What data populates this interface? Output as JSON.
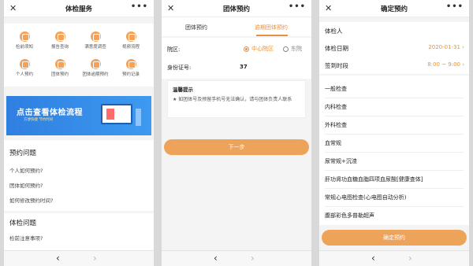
{
  "panel1": {
    "title": "体检服务",
    "grid": [
      {
        "label": "检前须知",
        "icon": "notice-icon"
      },
      {
        "label": "报告查询",
        "icon": "report-icon"
      },
      {
        "label": "满意度调查",
        "icon": "survey-icon"
      },
      {
        "label": "视频流程",
        "icon": "video-icon"
      },
      {
        "label": "个人预约",
        "icon": "personal-icon"
      },
      {
        "label": "团体预约",
        "icon": "group-icon"
      },
      {
        "label": "团体逾期预约",
        "icon": "overdue-icon"
      },
      {
        "label": "预约记录",
        "icon": "record-icon"
      }
    ],
    "banner_title": "点击查看体检流程",
    "banner_sub": "方便快捷 节约时间",
    "section1_title": "预约问题",
    "section1_items": [
      "个人如何预约?",
      "团体如何预约?",
      "如何修改预约时间?"
    ],
    "section2_title": "体检问题",
    "section2_items": [
      "检前注意事项?"
    ]
  },
  "panel2": {
    "title": "团体预约",
    "tab1": "团体预约",
    "tab2": "逾期团体预约",
    "hospital_label": "院区:",
    "option1": "中心院区",
    "option2": "东院",
    "id_label": "身份证号:",
    "id_value": "37",
    "tips_title": "温馨提示",
    "tips_text": "★ 如团体号及预留手机号无法确认，请与团体负责人联系",
    "next_button": "下一步"
  },
  "panel3": {
    "title": "确定预约",
    "person_label": "体检人",
    "date_label": "体检日期",
    "date_value": "2020-01-31 ›",
    "slot_label": "签到时段",
    "slot_value": "8:00 ~ 9:00 ›",
    "items": [
      "一般检查",
      "内科检查",
      "外科检查",
      "血常规",
      "尿常规+沉渣",
      "肝功肾功血糖血脂四项血尿酸[健康查体]",
      "常规心电图检查(心电图自动分析)",
      "腹部彩色多普勒超声"
    ],
    "confirm_button": "确定预约"
  },
  "common": {
    "close": "✕",
    "more": "•••",
    "back": "‹",
    "forward": "›"
  }
}
